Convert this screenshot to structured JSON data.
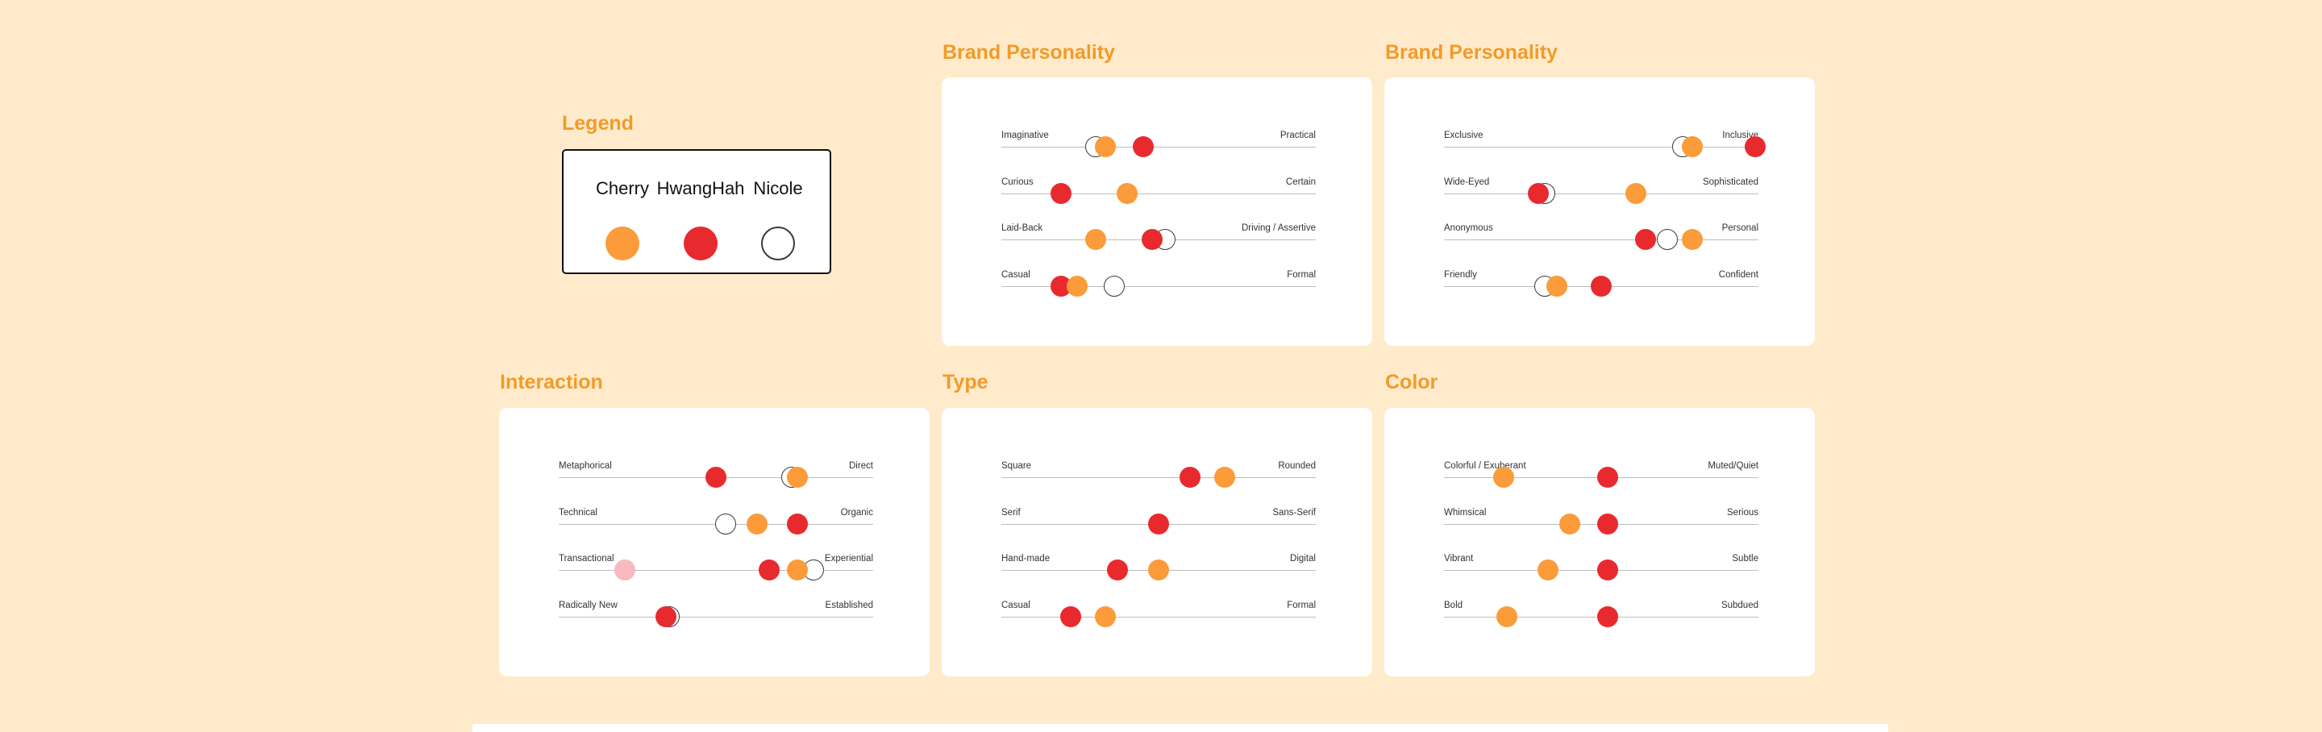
{
  "colors": {
    "background": "#FFEBCB",
    "title": "#F39A28",
    "card": "#FFFFFF",
    "cherry": "#FB9B3A",
    "hwanghah": "#E82A2E",
    "nicole_outline": "#3A3A3A",
    "track": "#BDBDBD"
  },
  "legend": {
    "title": "Legend",
    "people": [
      {
        "name": "Cherry",
        "marker": "orange-filled-circle"
      },
      {
        "name": "HwangHah",
        "marker": "red-filled-circle"
      },
      {
        "name": "Nicole",
        "marker": "white-outlined-circle"
      }
    ]
  },
  "panels": [
    {
      "title": "Brand Personality",
      "scales": [
        {
          "left": "Imaginative",
          "right": "Practical",
          "markers": [
            {
              "who": "nicole",
              "value": 0.3
            },
            {
              "who": "cherry",
              "value": 0.33
            },
            {
              "who": "hwanghah",
              "value": 0.45
            }
          ]
        },
        {
          "left": "Curious",
          "right": "Certain",
          "markers": [
            {
              "who": "hwanghah",
              "value": 0.19
            },
            {
              "who": "cherry",
              "value": 0.4
            }
          ]
        },
        {
          "left": "Laid-Back",
          "right": "Driving / Assertive",
          "markers": [
            {
              "who": "cherry",
              "value": 0.3
            },
            {
              "who": "nicole",
              "value": 0.52
            },
            {
              "who": "hwanghah",
              "value": 0.48
            }
          ]
        },
        {
          "left": "Casual",
          "right": "Formal",
          "markers": [
            {
              "who": "nicole",
              "value": 0.36
            },
            {
              "who": "hwanghah",
              "value": 0.19
            },
            {
              "who": "cherry",
              "value": 0.24
            }
          ]
        }
      ]
    },
    {
      "title": "Brand Personality",
      "scales": [
        {
          "left": "Exclusive",
          "right": "Inclusive",
          "markers": [
            {
              "who": "nicole",
              "value": 0.76
            },
            {
              "who": "cherry",
              "value": 0.79
            },
            {
              "who": "hwanghah",
              "value": 0.99
            }
          ]
        },
        {
          "left": "Wide-Eyed",
          "right": "Sophisticated",
          "markers": [
            {
              "who": "nicole",
              "value": 0.32
            },
            {
              "who": "hwanghah",
              "value": 0.3
            },
            {
              "who": "cherry",
              "value": 0.61
            }
          ]
        },
        {
          "left": "Anonymous",
          "right": "Personal",
          "markers": [
            {
              "who": "hwanghah",
              "value": 0.64
            },
            {
              "who": "nicole",
              "value": 0.71
            },
            {
              "who": "cherry",
              "value": 0.79
            }
          ]
        },
        {
          "left": "Friendly",
          "right": "Confident",
          "markers": [
            {
              "who": "nicole",
              "value": 0.32
            },
            {
              "who": "cherry",
              "value": 0.36
            },
            {
              "who": "hwanghah",
              "value": 0.5
            }
          ]
        }
      ]
    },
    {
      "title": "Interaction",
      "scales": [
        {
          "left": "Metaphorical",
          "right": "Direct",
          "markers": [
            {
              "who": "hwanghah",
              "value": 0.5
            },
            {
              "who": "nicole",
              "value": 0.74
            },
            {
              "who": "cherry",
              "value": 0.76
            }
          ]
        },
        {
          "left": "Technical",
          "right": "Organic",
          "markers": [
            {
              "who": "nicole",
              "value": 0.53
            },
            {
              "who": "cherry",
              "value": 0.63
            },
            {
              "who": "hwanghah",
              "value": 0.76
            }
          ]
        },
        {
          "left": "Transactional",
          "right": "Experiential",
          "markers": [
            {
              "who": "faint",
              "value": 0.21
            },
            {
              "who": "hwanghah",
              "value": 0.67
            },
            {
              "who": "nicole",
              "value": 0.81
            },
            {
              "who": "cherry",
              "value": 0.76
            }
          ]
        },
        {
          "left": "Radically New",
          "right": "Established",
          "markers": [
            {
              "who": "nicole",
              "value": 0.35
            },
            {
              "who": "hwanghah",
              "value": 0.34
            }
          ]
        }
      ]
    },
    {
      "title": "Type",
      "scales": [
        {
          "left": "Square",
          "right": "Rounded",
          "markers": [
            {
              "who": "hwanghah",
              "value": 0.6
            },
            {
              "who": "cherry",
              "value": 0.71
            }
          ]
        },
        {
          "left": "Serif",
          "right": "Sans-Serif",
          "markers": [
            {
              "who": "hwanghah",
              "value": 0.5
            }
          ]
        },
        {
          "left": "Hand-made",
          "right": "Digital",
          "markers": [
            {
              "who": "hwanghah",
              "value": 0.37
            },
            {
              "who": "cherry",
              "value": 0.5
            }
          ]
        },
        {
          "left": "Casual",
          "right": "Formal",
          "markers": [
            {
              "who": "hwanghah",
              "value": 0.22
            },
            {
              "who": "cherry",
              "value": 0.33
            }
          ]
        }
      ]
    },
    {
      "title": "Color",
      "scales": [
        {
          "left": "Colorful / Exuberant",
          "right": "Muted/Quiet",
          "markers": [
            {
              "who": "cherry",
              "value": 0.19
            },
            {
              "who": "hwanghah",
              "value": 0.52
            }
          ]
        },
        {
          "left": "Whimsical",
          "right": "Serious",
          "markers": [
            {
              "who": "cherry",
              "value": 0.4
            },
            {
              "who": "hwanghah",
              "value": 0.52
            }
          ]
        },
        {
          "left": "Vibrant",
          "right": "Subtle",
          "markers": [
            {
              "who": "cherry",
              "value": 0.33
            },
            {
              "who": "hwanghah",
              "value": 0.52
            }
          ]
        },
        {
          "left": "Bold",
          "right": "Subdued",
          "markers": [
            {
              "who": "cherry",
              "value": 0.2
            },
            {
              "who": "hwanghah",
              "value": 0.52
            }
          ]
        }
      ]
    }
  ]
}
